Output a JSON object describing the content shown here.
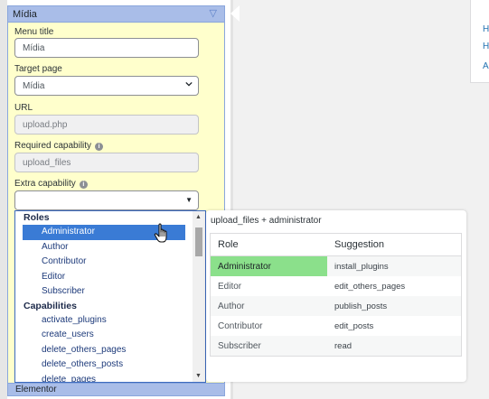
{
  "panel": {
    "title": "Mídia",
    "toggle_glyph": "▽",
    "fields": {
      "menu_title_label": "Menu title",
      "menu_title_value": "Mídia",
      "target_page_label": "Target page",
      "target_page_value": "Mídia",
      "url_label": "URL",
      "url_value": "upload.php",
      "required_cap_label": "Required capability",
      "required_cap_value": "upload_files",
      "extra_cap_label": "Extra capability",
      "extra_cap_value": "",
      "combo_arrow": "▼",
      "info_glyph": "i"
    }
  },
  "dropdown": {
    "groups": [
      {
        "label": "Roles",
        "items": [
          "Administrator",
          "Author",
          "Contributor",
          "Editor",
          "Subscriber"
        ]
      },
      {
        "label": "Capabilities",
        "items": [
          "activate_plugins",
          "create_users",
          "delete_others_pages",
          "delete_others_posts",
          "delete_pages"
        ]
      }
    ],
    "selected": "Administrator",
    "scroll_up": "▲",
    "scroll_down": "▼"
  },
  "tooltip": {
    "caption": "upload_files + administrator",
    "headers": [
      "Role",
      "Suggestion"
    ],
    "rows": [
      {
        "role": "Administrator",
        "suggestion": "install_plugins",
        "highlight": true
      },
      {
        "role": "Editor",
        "suggestion": "edit_others_pages",
        "highlight": false
      },
      {
        "role": "Author",
        "suggestion": "publish_posts",
        "highlight": false
      },
      {
        "role": "Contributor",
        "suggestion": "edit_posts",
        "highlight": false
      },
      {
        "role": "Subscriber",
        "suggestion": "read",
        "highlight": false
      }
    ],
    "highlight_color": "#8be08b"
  },
  "next_panel": {
    "title": "Elementor"
  },
  "right_panel": {
    "items": [
      "H",
      "H",
      "A"
    ]
  },
  "colors": {
    "panel_header": "#a9bde8",
    "panel_body": "#ffffcc",
    "selection": "#3a7bd5",
    "link": "#2271b1"
  }
}
